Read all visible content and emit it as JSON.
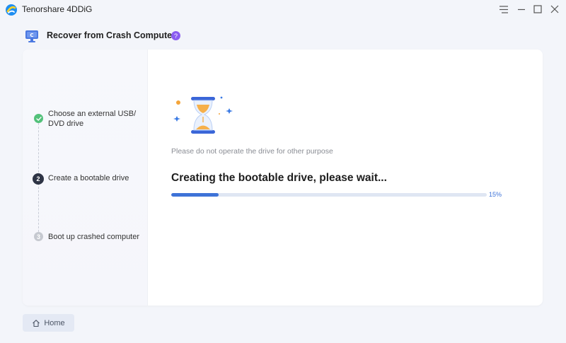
{
  "app": {
    "name": "Tenorshare 4DDiG"
  },
  "header": {
    "title": "Recover from Crash Computer",
    "help": "?"
  },
  "steps": [
    {
      "label": "Choose an external USB/ DVD drive",
      "status": "done",
      "marker": ""
    },
    {
      "label": "Create a bootable drive",
      "status": "active",
      "marker": "2"
    },
    {
      "label": "Boot up crashed computer",
      "status": "pending",
      "marker": "3"
    }
  ],
  "main": {
    "notice": "Please do not operate the drive for other purpose",
    "status_title": "Creating the bootable drive, please wait...",
    "progress": {
      "value": 15,
      "label": "15%"
    }
  },
  "footer": {
    "home_label": "Home"
  },
  "icons": {
    "app": "4ddig-logo-icon",
    "header": "computer-boot-icon",
    "hourglass": "hourglass-icon",
    "home": "home-icon"
  },
  "colors": {
    "accent": "#3e73d8",
    "done": "#52c17a",
    "active": "#2e3445",
    "pending": "#c6c9d0",
    "help": "#8a5cf0"
  }
}
